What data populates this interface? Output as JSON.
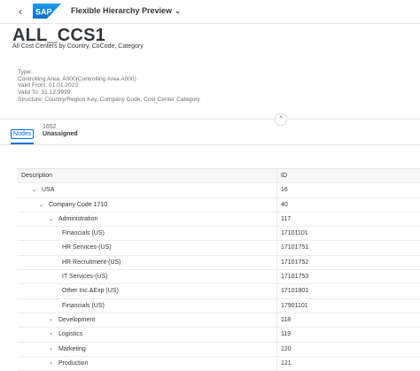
{
  "shell": {
    "back_icon": "chevron-left-icon",
    "logo_text": "SAP",
    "app_title": "Flexible Hierarchy Preview",
    "app_title_chevron": "chevron-down-icon",
    "brand_color": "#0a6ed1"
  },
  "header": {
    "title": "ALL_CCS1",
    "subtitle": "All Cost Centers by Country, CoCode, Category",
    "meta": [
      "Type:",
      "Controlling Area: A000(Controlling Area A000)",
      "Valid From: 01.01.2023",
      "Valid To: 31.12.9999",
      "Structure: Country/Region Key, Company Code, Cost Center Category"
    ]
  },
  "tabs": {
    "nodes_label": "Nodes",
    "unassigned_count": "1652",
    "unassigned_label": "Unassigned"
  },
  "table": {
    "columns": [
      "Description",
      "ID"
    ],
    "rows": [
      {
        "level": 1,
        "toggle": "⌄",
        "desc": "USA",
        "id": "16"
      },
      {
        "level": 2,
        "toggle": "⌄",
        "desc": "Company Code 1710",
        "id": "40"
      },
      {
        "level": 3,
        "toggle": "⌄",
        "desc": "Administration",
        "id": "117"
      },
      {
        "level": 4,
        "toggle": "",
        "desc": "Financials (US)",
        "id": "17101101"
      },
      {
        "level": 4,
        "toggle": "",
        "desc": "HR Services-(US)",
        "id": "17101751"
      },
      {
        "level": 4,
        "toggle": "",
        "desc": "HR Recruitment-(US)",
        "id": "17101752"
      },
      {
        "level": 4,
        "toggle": "",
        "desc": "IT Services-(US)",
        "id": "17101753"
      },
      {
        "level": 4,
        "toggle": "",
        "desc": "Other Inc.&Exp (US)",
        "id": "17101801"
      },
      {
        "level": 4,
        "toggle": "",
        "desc": "Financials (US)",
        "id": "17901101"
      },
      {
        "level": 3,
        "toggle": "›",
        "desc": "Development",
        "id": "118"
      },
      {
        "level": 3,
        "toggle": "›",
        "desc": "Logistics",
        "id": "119"
      },
      {
        "level": 3,
        "toggle": "›",
        "desc": "Marketing",
        "id": "120"
      },
      {
        "level": 3,
        "toggle": "›",
        "desc": "Production",
        "id": "121"
      }
    ]
  }
}
